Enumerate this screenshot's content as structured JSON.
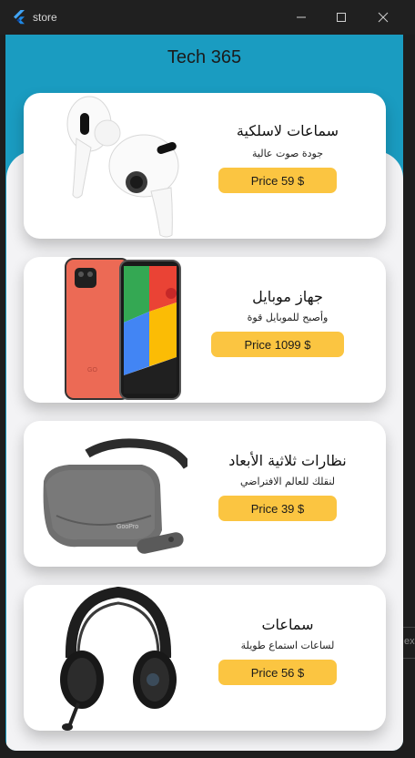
{
  "window": {
    "title": "store"
  },
  "app": {
    "header_title": "Tech 365"
  },
  "products": [
    {
      "title": "سماعات لاسلكية",
      "subtitle": "جودة صوت عالية",
      "price": "Price 59 $",
      "image": "airpods-icon"
    },
    {
      "title": "جهاز موبايل",
      "subtitle": "وأصبح للموبايل قوة",
      "price": "Price 1099 $",
      "image": "smartphone-icon"
    },
    {
      "title": "نظارات ثلاثية الأبعاد",
      "subtitle": "لنقلك للعالم الافتراضي",
      "price": "Price 39 $",
      "image": "vr-headset-icon"
    },
    {
      "title": "سماعات",
      "subtitle": "لساعات استماع طويلة",
      "price": "Price 56 $",
      "image": "headphones-icon"
    }
  ],
  "background_strip": {
    "text": "ex"
  },
  "colors": {
    "accent": "#1a9cc1",
    "price_button": "#fbc541",
    "card": "#ffffff",
    "sheet": "#f3f3f5",
    "titlebar": "#202020"
  }
}
